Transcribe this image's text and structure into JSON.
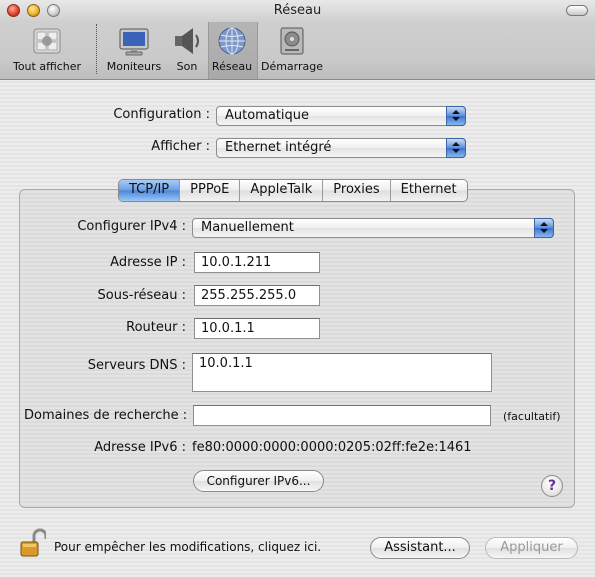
{
  "window": {
    "title": "Réseau"
  },
  "toolbar": {
    "items": [
      {
        "label": "Tout afficher",
        "icon": "apple-grid-icon"
      },
      {
        "label": "Moniteurs",
        "icon": "monitor-icon"
      },
      {
        "label": "Son",
        "icon": "speaker-icon"
      },
      {
        "label": "Réseau",
        "icon": "network-globe-icon",
        "selected": true
      },
      {
        "label": "Démarrage",
        "icon": "hard-disk-icon"
      }
    ]
  },
  "config": {
    "configuration_label": "Configuration :",
    "configuration_value": "Automatique",
    "afficher_label": "Afficher :",
    "afficher_value": "Ethernet intégré"
  },
  "tabs": [
    "TCP/IP",
    "PPPoE",
    "AppleTalk",
    "Proxies",
    "Ethernet"
  ],
  "active_tab": "TCP/IP",
  "tcpip": {
    "ipv4_label": "Configurer IPv4 :",
    "ipv4_value": "Manuellement",
    "ip_label": "Adresse IP :",
    "ip_value": "10.0.1.211",
    "subnet_label": "Sous-réseau :",
    "subnet_value": "255.255.255.0",
    "router_label": "Routeur :",
    "router_value": "10.0.1.1",
    "dns_label": "Serveurs DNS :",
    "dns_value": "10.0.1.1",
    "search_label": "Domaines de recherche :",
    "search_value": "",
    "optional_note": "(facultatif)",
    "ipv6_label": "Adresse IPv6 :",
    "ipv6_value": "fe80:0000:0000:0000:0205:02ff:fe2e:1461",
    "ipv6_button": "Configurer IPv6...",
    "help": "?"
  },
  "footer": {
    "lock_text": "Pour empêcher les modifications, cliquez ici.",
    "assistant_button": "Assistant...",
    "apply_button": "Appliquer"
  },
  "colors": {
    "accent": "#3a74d0",
    "help_glyph": "#6b2fa0"
  }
}
